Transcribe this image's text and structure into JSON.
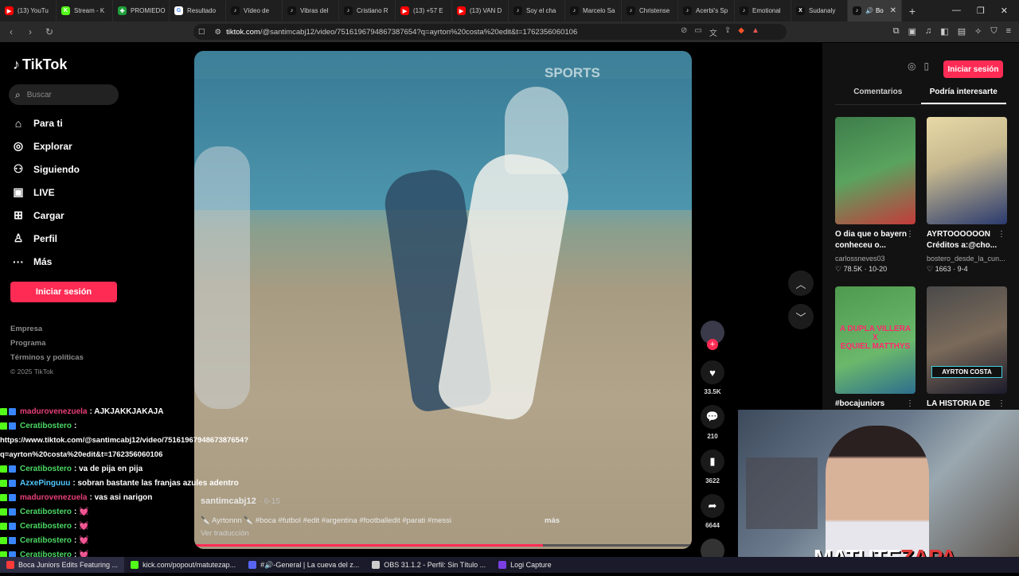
{
  "browser": {
    "tabs": [
      {
        "label": "(13) YouTu",
        "color": "#ff0000",
        "glyph": "▶"
      },
      {
        "label": "Stream - K",
        "color": "#53fc18",
        "glyph": "K"
      },
      {
        "label": "PROMIEDO",
        "color": "#1e9e3a",
        "glyph": "✚"
      },
      {
        "label": "Resultado",
        "color": "#ffffff",
        "glyph": "G"
      },
      {
        "label": "Vídeo de",
        "color": "#111111",
        "glyph": "♪"
      },
      {
        "label": "Vibras del",
        "color": "#111111",
        "glyph": "♪"
      },
      {
        "label": "Cristiano R",
        "color": "#111111",
        "glyph": "♪"
      },
      {
        "label": "(13) +57 E",
        "color": "#ff0000",
        "glyph": "▶"
      },
      {
        "label": "(13) VAN D",
        "color": "#ff0000",
        "glyph": "▶"
      },
      {
        "label": "Soy el cha",
        "color": "#111111",
        "glyph": "♪"
      },
      {
        "label": "Marcelo Sa",
        "color": "#111111",
        "glyph": "♪"
      },
      {
        "label": "Christense",
        "color": "#111111",
        "glyph": "♪"
      },
      {
        "label": "Acerbi's Sp",
        "color": "#111111",
        "glyph": "♪"
      },
      {
        "label": "Emotional",
        "color": "#111111",
        "glyph": "♪"
      },
      {
        "label": "Sudanaly",
        "color": "#111111",
        "glyph": "X"
      }
    ],
    "active_tab": {
      "label": "Bo",
      "close": "✕"
    },
    "new_tab": "+",
    "window_controls": {
      "minimize": "—",
      "restore": "❐",
      "close": "✕"
    },
    "url": {
      "host": "tiktok.com",
      "path": "/@santimcabj12/video/7516196794867387654?q=ayrton%20costa%20edit&t=1762356060106"
    }
  },
  "tiktok": {
    "logo": "TikTok",
    "search_placeholder": "Buscar",
    "nav": [
      {
        "label": "Para ti",
        "icon": "home-icon",
        "glyph": "⌂"
      },
      {
        "label": "Explorar",
        "icon": "compass-icon",
        "glyph": "◎"
      },
      {
        "label": "Siguiendo",
        "icon": "following-icon",
        "glyph": "⚇"
      },
      {
        "label": "LIVE",
        "icon": "live-icon",
        "glyph": "▣"
      },
      {
        "label": "Cargar",
        "icon": "upload-icon",
        "glyph": "⊞"
      },
      {
        "label": "Perfil",
        "icon": "profile-icon",
        "glyph": "♙"
      },
      {
        "label": "Más",
        "icon": "more-icon",
        "glyph": "···"
      }
    ],
    "login_label": "Iniciar sesión",
    "footer": [
      "Empresa",
      "Programa",
      "Términos y políticas"
    ],
    "copyright": "© 2025 TikTok"
  },
  "video": {
    "watermark": "SPORTS",
    "author": "santimcabj12",
    "date": "· 6-15",
    "caption": "🔪 Ayrtonnn 🔪 #boca #futbol #edit #argentina #footballedit #parati #messi",
    "more": "más",
    "see_translation": "Ver traducción",
    "progress": 0.7,
    "likes": "33.5K",
    "comments": "210",
    "saves": "3622",
    "shares": "6644"
  },
  "right_panel": {
    "login_label": "Iniciar sesión",
    "tabs": [
      "Comentarios",
      "Podría interesarte"
    ],
    "active_tab": 1,
    "cards": [
      {
        "title": "O dia que o bayern\nconheceu o...",
        "user": "carlossneves03",
        "likes": "78.5K",
        "date": "10-20",
        "bg": "linear-gradient(160deg,#3d7d4a,#5aa35f 50%,#c43b3b)"
      },
      {
        "title": "AYRTOOOOOON\nCréditos a:@cho...",
        "user": "bostero_desde_la_cun...",
        "likes": "1663",
        "date": "9-4",
        "bg": "linear-gradient(160deg,#e8d9a6,#c7b98f 40%,#2a3a6e)"
      },
      {
        "title": "#bocajuniors",
        "user": "",
        "likes": "",
        "date": "",
        "bg": "linear-gradient(160deg,#4e9a4e,#6bb86b 60%,#2d6e8e)",
        "overlay": "A DUPLA VILLERA\nX\nEQUIEL MATTHYS"
      },
      {
        "title": "LA HISTORIA DE",
        "user": "",
        "likes": "",
        "date": "",
        "bg": "linear-gradient(160deg,#4a4a4a,#7a6a5a 50%,#1a1a2a)",
        "overlay": "AYRTON COSTA"
      }
    ]
  },
  "chat": [
    {
      "user": "madurovenezuela",
      "color": "u1",
      "text": ": AJKJAKKJAKAJA"
    },
    {
      "user": "Ceratibostero",
      "color": "u2",
      "text": ":"
    },
    {
      "url": "https://www.tiktok.com/@santimcabj12/video/7516196794867387654?"
    },
    {
      "url": "q=ayrton%20costa%20edit&t=1762356060106"
    },
    {
      "user": "Ceratibostero",
      "color": "u2",
      "text": ": va de pija en pija"
    },
    {
      "user": "AzxePinguuu",
      "color": "u3",
      "text": ": sobran bastante las franjas azules adentro"
    },
    {
      "user": "madurovenezuela",
      "color": "u1",
      "text": ": vas asi narigon"
    },
    {
      "user": "Ceratibostero",
      "color": "u2",
      "text": ": 💓"
    },
    {
      "user": "Ceratibostero",
      "color": "u2",
      "text": ": 💓"
    },
    {
      "user": "Ceratibostero",
      "color": "u2",
      "text": ": 💓"
    },
    {
      "user": "Ceratibostero",
      "color": "u2",
      "text": ": 💓"
    },
    {
      "user": "Ceratibostero",
      "color": "u2",
      "text": ": 💓"
    }
  ],
  "webcam": {
    "name_a": "MATUTE",
    "name_b": "ZAPA"
  },
  "taskbar": [
    {
      "label": "Boca Juniors Edits Featuring ...",
      "color": "#ff3b3b",
      "active": true
    },
    {
      "label": "kick.com/popout/matutezap...",
      "color": "#53fc18",
      "active": false
    },
    {
      "label": "#🔊-General | La cueva del z...",
      "color": "#5865f2",
      "active": false
    },
    {
      "label": "OBS 31.1.2 - Perfil: Sin Título ...",
      "color": "#cccccc",
      "active": false
    },
    {
      "label": "Logi Capture",
      "color": "#7b3fe4",
      "active": false
    }
  ]
}
